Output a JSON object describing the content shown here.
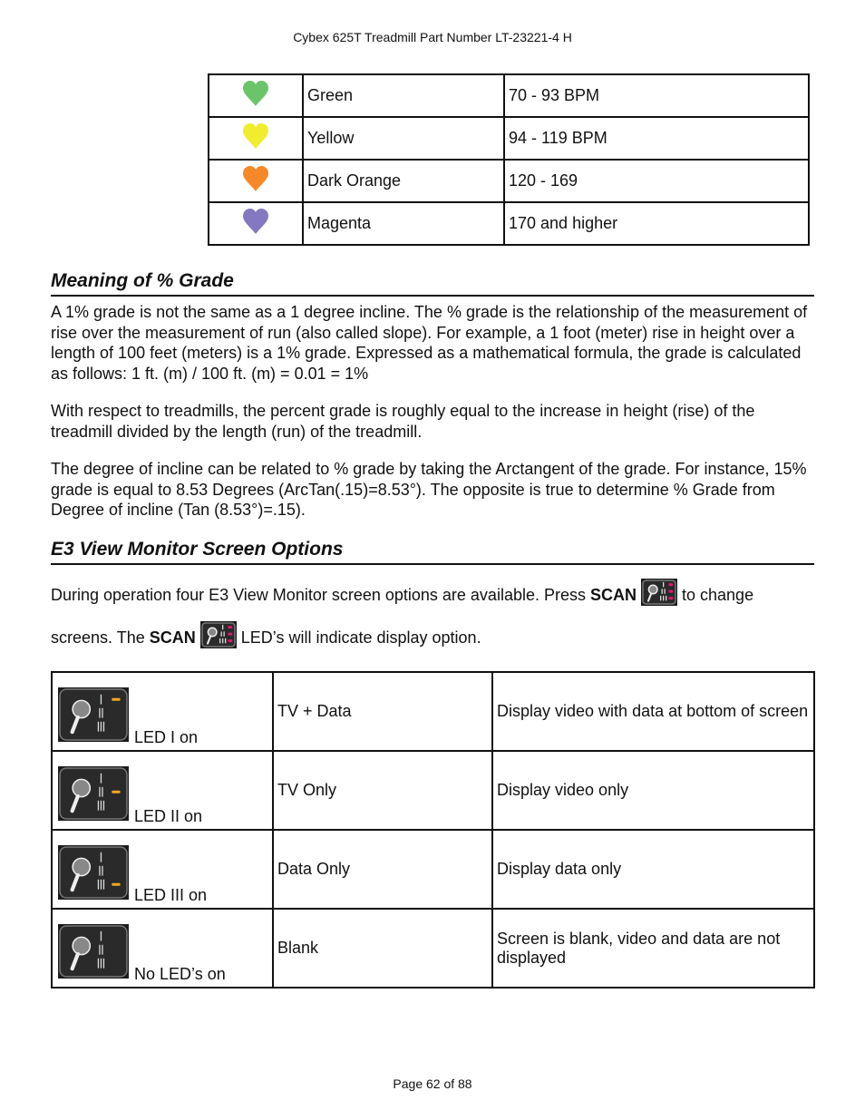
{
  "header": {
    "title": "Cybex 625T Treadmill Part Number LT-23221-4 H"
  },
  "heart_rate_table": {
    "rows": [
      {
        "icon": "heart-icon",
        "color": "#6cc46a",
        "name": "Green",
        "range": "70 - 93 BPM"
      },
      {
        "icon": "heart-icon",
        "color": "#f2ec30",
        "name": "Yellow",
        "range": "94 - 119 BPM"
      },
      {
        "icon": "heart-icon",
        "color": "#f5892a",
        "name": "Dark Orange",
        "range": "120 - 169"
      },
      {
        "icon": "heart-icon",
        "color": "#8478c0",
        "name": "Magenta",
        "range": "170 and higher"
      }
    ]
  },
  "grade_section": {
    "heading": "Meaning of % Grade",
    "p1": "A 1% grade is not the same as a 1 degree incline. The % grade is the relationship of the measurement of rise over the measurement of run (also called slope). For example, a 1 foot (meter) rise in height over a length of 100 feet (meters) is a 1% grade. Expressed as a mathematical formula, the grade is calculated as follows: 1 ft. (m) / 100 ft. (m) = 0.01 = 1%",
    "p2": "With respect to treadmills, the percent grade is roughly equal to the increase in height (rise) of the treadmill divided by the length (run) of the treadmill.",
    "p3": "The degree of incline can be related to % grade by taking the Arctangent of the grade. For instance, 15% grade is equal to 8.53 Degrees (ArcTan(.15)=8.53°). The opposite is true to determine % Grade from Degree of incline (Tan (8.53°)=.15)."
  },
  "e3_section": {
    "heading": "E3 View Monitor Screen Options",
    "intro_a": "During operation four E3 View Monitor screen options are available. Press ",
    "scan_bold": "SCAN",
    "intro_b": " to change screens. The ",
    "intro_c": " LED’s will indicate display option.",
    "led_on_color": "#f5a623",
    "scan_led_color": "#e0186e",
    "rows": [
      {
        "led_label": "LED I on",
        "mode": "TV + Data",
        "description": "Display video with data at bottom of screen",
        "led_lit": 1
      },
      {
        "led_label": "LED II on",
        "mode": "TV Only",
        "description": "Display video only",
        "led_lit": 2
      },
      {
        "led_label": "LED III on",
        "mode": "Data Only",
        "description": "Display data only",
        "led_lit": 3
      },
      {
        "led_label": "No LED’s on",
        "mode": "Blank",
        "description": "Screen is blank, video and data are not displayed",
        "led_lit": 0
      }
    ]
  },
  "footer": {
    "page": "Page 62 of 88"
  }
}
